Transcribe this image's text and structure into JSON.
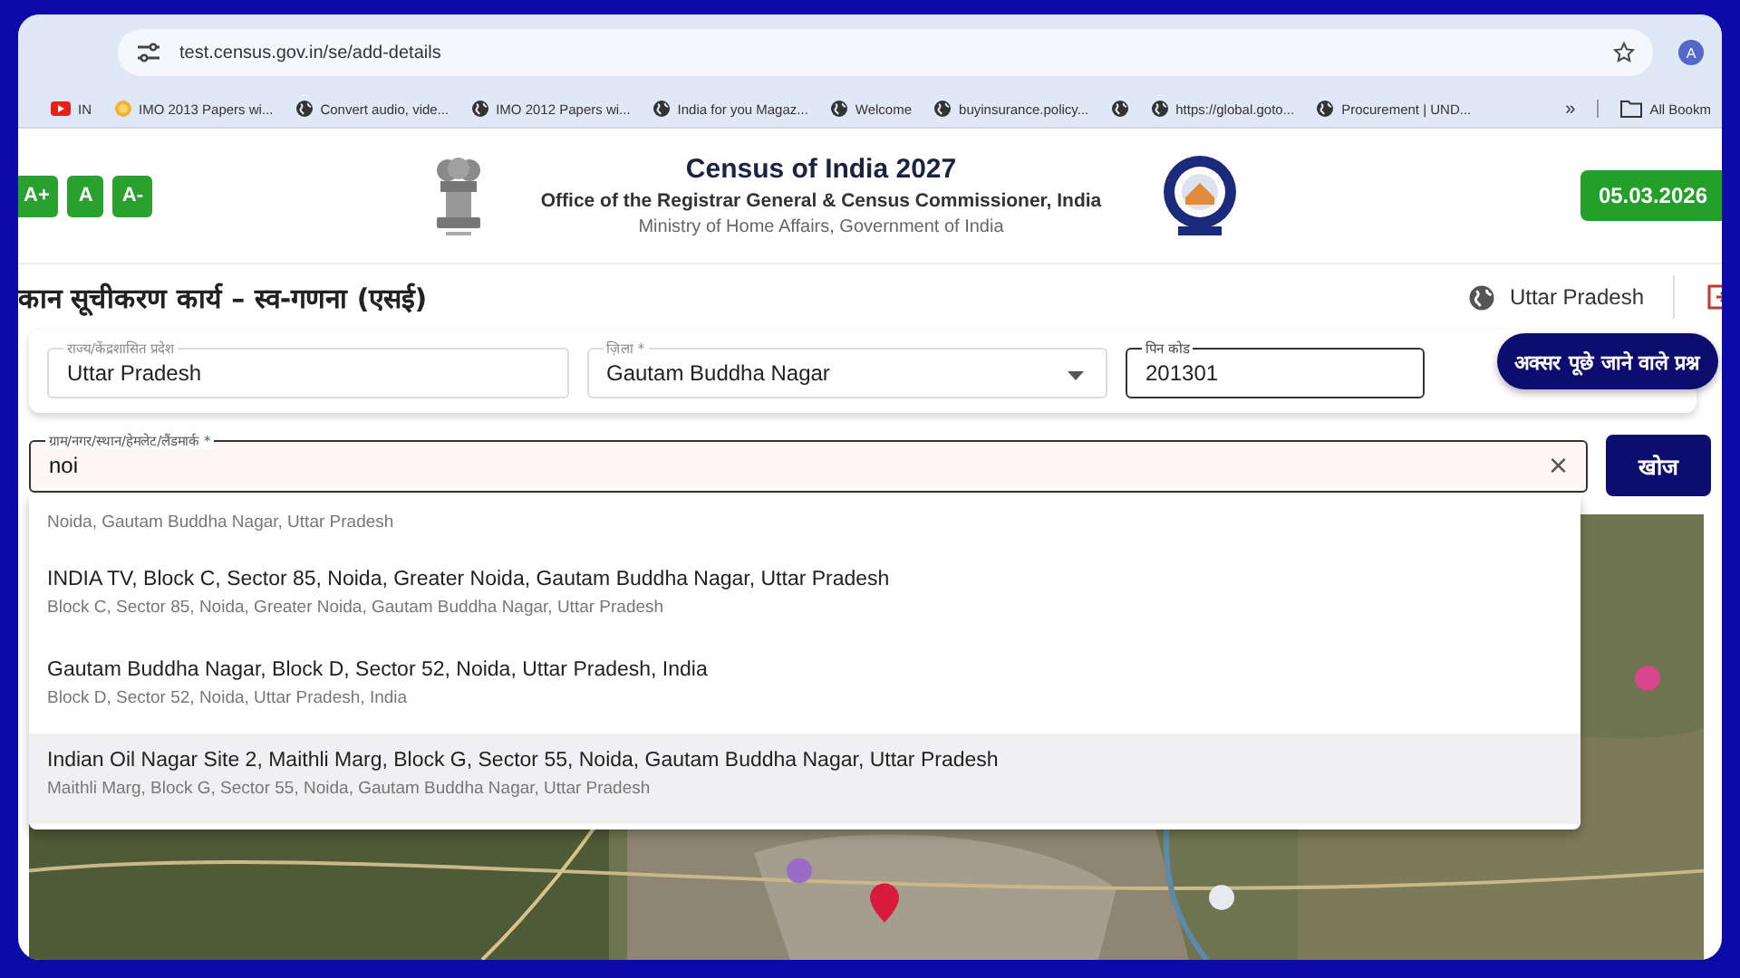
{
  "browser": {
    "url": "test.census.gov.in/se/add-details",
    "profile_initial": "A",
    "bookmarks": [
      {
        "kind": "youtube",
        "label": "IN"
      },
      {
        "kind": "coin",
        "label": "IMO 2013 Papers wi..."
      },
      {
        "kind": "globe",
        "label": "Convert audio, vide..."
      },
      {
        "kind": "globe",
        "label": "IMO 2012 Papers wi..."
      },
      {
        "kind": "globe",
        "label": "India for you Magaz..."
      },
      {
        "kind": "globe",
        "label": "Welcome"
      },
      {
        "kind": "globe",
        "label": "buyinsurance.policy..."
      },
      {
        "kind": "globe"
      },
      {
        "kind": "globe",
        "label": "https://global.goto..."
      },
      {
        "kind": "globe",
        "label": "Procurement | UND..."
      }
    ],
    "more": "»",
    "all_bookmarks": "All Bookm"
  },
  "header": {
    "font_buttons": [
      "A+",
      "A",
      "A-"
    ],
    "title": "Census of India 2027",
    "subtitle": "Office of the Registrar General & Census Commissioner, India",
    "ministry": "Ministry of Home Affairs, Government of India",
    "date": "05.03.2026"
  },
  "page": {
    "title": "कान सूचीकरण कार्य – स्व-गणना (एसई)",
    "state_link": "Uttar Pradesh"
  },
  "form": {
    "fields": [
      {
        "kind": "readonly",
        "label": "राज्य/केंद्रशासित प्रदेश",
        "value": "Uttar Pradesh"
      },
      {
        "kind": "select",
        "label": "ज़िला *",
        "value": "Gautam Buddha Nagar"
      },
      {
        "kind": "focused",
        "label": "पिन कोड",
        "value": "201301"
      }
    ],
    "faq_button": "अक्सर पूछे जाने वाले प्रश्न"
  },
  "search": {
    "label": "ग्राम/नगर/स्थान/हेमलेट/लैंडमार्क *",
    "value": "noi",
    "clear": "×",
    "button": "खोज"
  },
  "suggestions": [
    {
      "sub": "Noida, Gautam Buddha Nagar, Uttar Pradesh",
      "highlighted": false
    },
    {
      "main": "INDIA TV, Block C, Sector 85, Noida, Greater Noida, Gautam Buddha Nagar, Uttar Pradesh",
      "sub": "Block C, Sector 85, Noida, Greater Noida, Gautam Buddha Nagar, Uttar Pradesh",
      "highlighted": false
    },
    {
      "main": "Gautam Buddha Nagar, Block D, Sector 52, Noida, Uttar Pradesh, India",
      "sub": "Block D, Sector 52, Noida, Uttar Pradesh, India",
      "highlighted": false
    },
    {
      "main": "Indian Oil Nagar Site 2, Maithli Marg, Block G, Sector 55, Noida, Gautam Buddha Nagar, Uttar Pradesh",
      "sub": "Maithli Marg, Block G, Sector 55, Noida, Gautam Buddha Nagar, Uttar Pradesh",
      "highlighted": true
    }
  ]
}
